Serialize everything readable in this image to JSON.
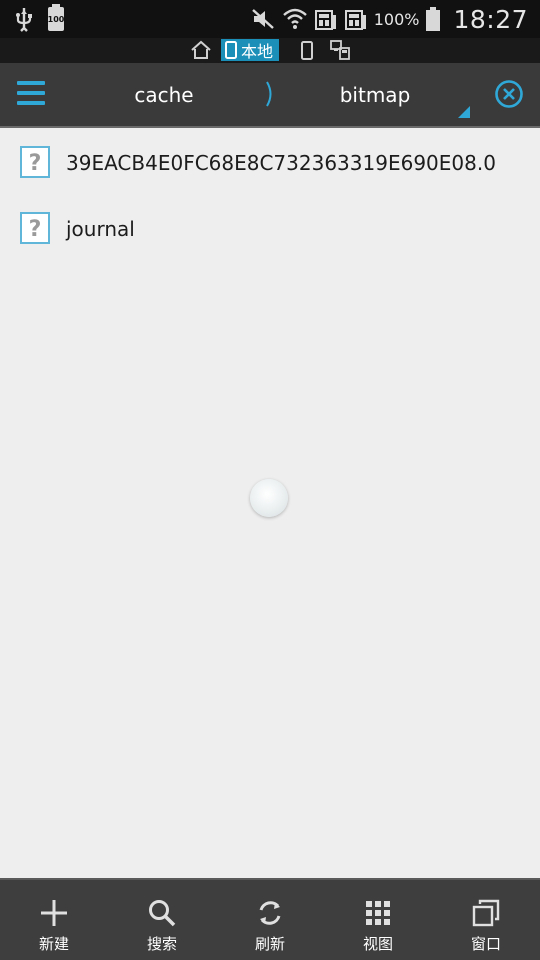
{
  "status_bar": {
    "battery_small_text": "100",
    "battery_percent": "100%",
    "time": "18:27"
  },
  "location_strip": {
    "local_label": "本地"
  },
  "path_bar": {
    "crumbs": [
      {
        "label": "cache"
      },
      {
        "label": "bitmap"
      }
    ],
    "separator": "〉"
  },
  "files": [
    {
      "name": "39EACB4E0FC68E8C732363319E690E08.0",
      "icon": "unknown-file-icon"
    },
    {
      "name": "journal",
      "icon": "unknown-file-icon"
    }
  ],
  "toolbar": {
    "new_label": "新建",
    "search_label": "搜索",
    "refresh_label": "刷新",
    "view_label": "视图",
    "window_label": "窗口"
  },
  "colors": {
    "accent": "#2fa8d8",
    "location_highlight": "#1b8fb8",
    "path_bar_bg": "#3a3a3a",
    "toolbar_bg": "#3e3e3e",
    "list_bg": "#eeeeee"
  }
}
